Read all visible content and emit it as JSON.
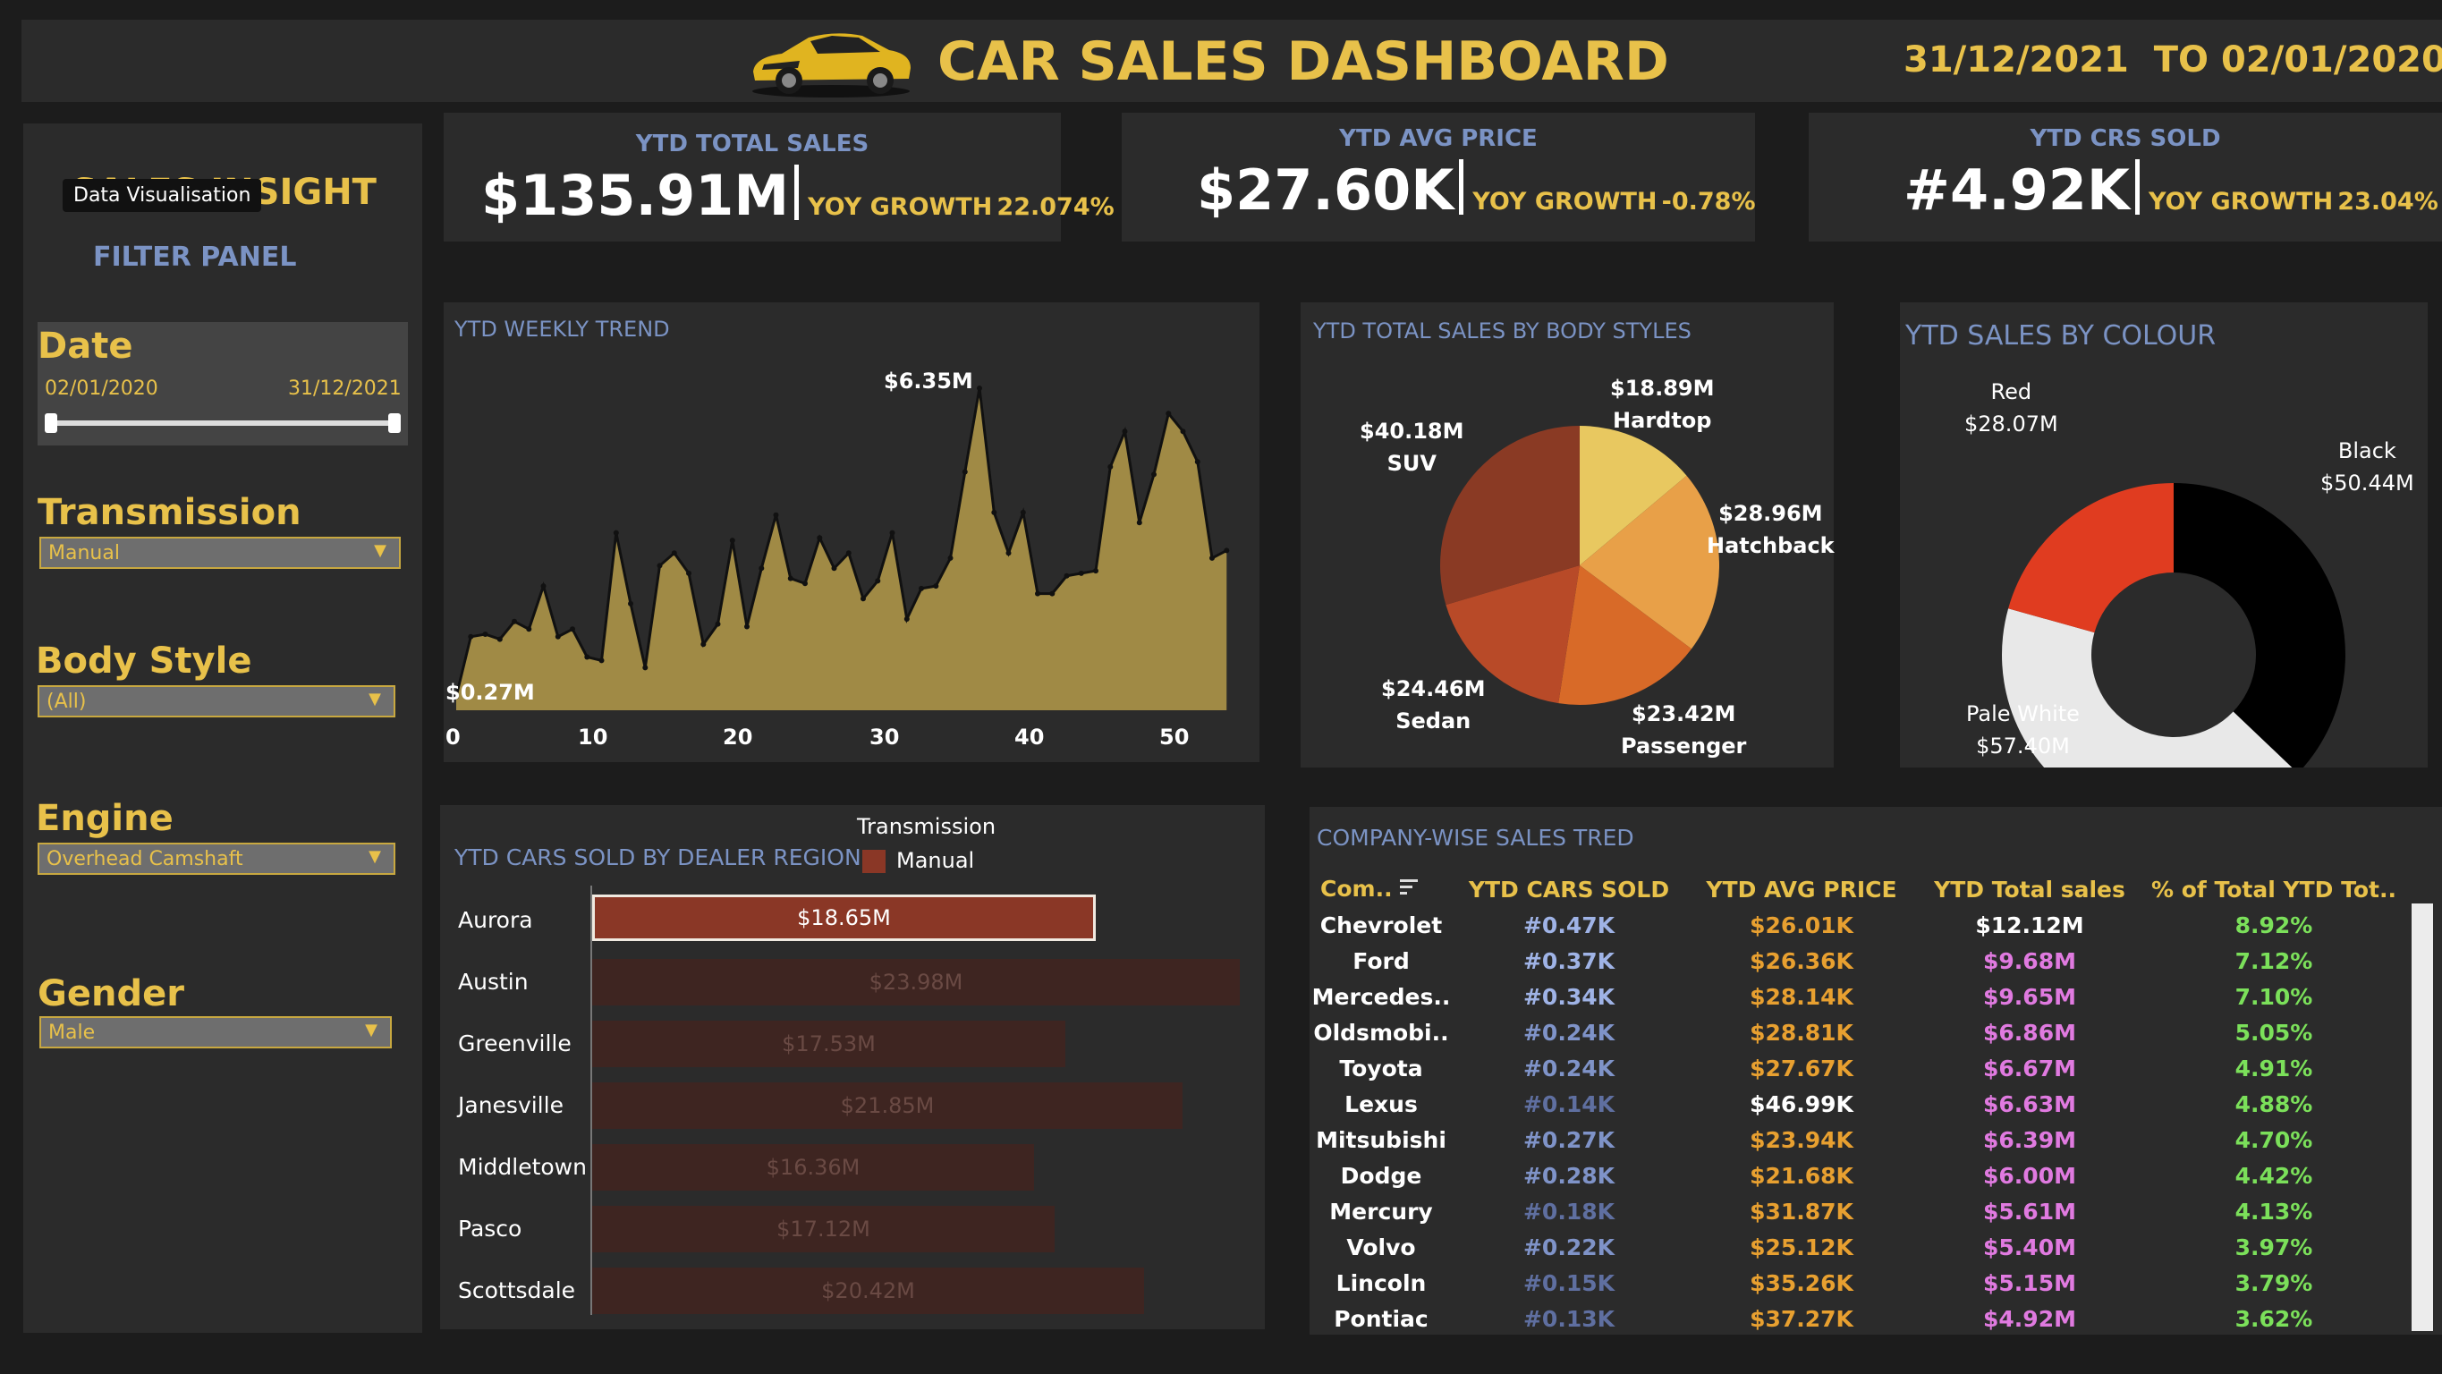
{
  "header": {
    "title": "CAR SALES DASHBOARD",
    "date_range": "31/12/2021  TO 02/01/2020"
  },
  "sidebar": {
    "heading": "SALES INSIGHT",
    "tooltip": "Data Visualisation",
    "filter_panel": "FILTER PANEL",
    "date": {
      "label": "Date",
      "start": "02/01/2020",
      "end": "31/12/2021"
    },
    "transmission": {
      "label": "Transmission",
      "value": "Manual"
    },
    "body_style": {
      "label": "Body Style",
      "value": "(All)"
    },
    "engine": {
      "label": "Engine",
      "value": "Overhead Camshaft"
    },
    "gender": {
      "label": "Gender",
      "value": "Male"
    }
  },
  "kpis": {
    "sales": {
      "title": "YTD TOTAL SALES",
      "value": "$135.91M",
      "yoy_label": "YOY GROWTH",
      "yoy": "22.074%"
    },
    "price": {
      "title": "YTD AVG PRICE",
      "value": "$27.60K",
      "yoy_label": "YOY GROWTH",
      "yoy": "-0.78%"
    },
    "sold": {
      "title": "YTD CRS SOLD",
      "value": "#4.92K",
      "yoy_label": "YOY GROWTH",
      "yoy": "23.04%"
    }
  },
  "weekly_trend": {
    "title": "YTD WEEKLY TREND",
    "max_label": "$6.35M",
    "min_label": "$0.27M",
    "x_ticks": [
      "0",
      "10",
      "20",
      "30",
      "40",
      "50"
    ]
  },
  "body_styles": {
    "title": "YTD TOTAL SALES BY BODY STYLES",
    "slices": [
      {
        "name": "Hardtop",
        "value": "$18.89M"
      },
      {
        "name": "Hatchback",
        "value": "$28.96M"
      },
      {
        "name": "Passenger",
        "value": "$23.42M"
      },
      {
        "name": "Sedan",
        "value": "$24.46M"
      },
      {
        "name": "SUV",
        "value": "$40.18M"
      }
    ]
  },
  "colour": {
    "title": "YTD SALES BY COLOUR",
    "slices": [
      {
        "name": "Black",
        "value": "$50.44M"
      },
      {
        "name": "Pale White",
        "value": "$57.40M"
      },
      {
        "name": "Red",
        "value": "$28.07M"
      }
    ]
  },
  "dealer_region": {
    "title": "YTD CARS SOLD BY DEALER REGION",
    "legend_title": "Transmission",
    "legend_item": "Manual",
    "regions": [
      {
        "name": "Aurora",
        "value": "$18.65M"
      },
      {
        "name": "Austin",
        "value": "$23.98M"
      },
      {
        "name": "Greenville",
        "value": "$17.53M"
      },
      {
        "name": "Janesville",
        "value": "$21.85M"
      },
      {
        "name": "Middletown",
        "value": "$16.36M"
      },
      {
        "name": "Pasco",
        "value": "$17.12M"
      },
      {
        "name": "Scottsdale",
        "value": "$20.42M"
      }
    ]
  },
  "company_table": {
    "title": "COMPANY-WISE SALES TRED",
    "headers": [
      "Com..",
      "YTD CARS SOLD",
      "YTD AVG PRICE",
      "YTD Total sales",
      "% of Total YTD Tot.."
    ],
    "rows": [
      [
        "Chevrolet",
        "#0.47K",
        "$26.01K",
        "$12.12M",
        "8.92%"
      ],
      [
        "Ford",
        "#0.37K",
        "$26.36K",
        "$9.68M",
        "7.12%"
      ],
      [
        "Mercedes..",
        "#0.34K",
        "$28.14K",
        "$9.65M",
        "7.10%"
      ],
      [
        "Oldsmobi..",
        "#0.24K",
        "$28.81K",
        "$6.86M",
        "5.05%"
      ],
      [
        "Toyota",
        "#0.24K",
        "$27.67K",
        "$6.67M",
        "4.91%"
      ],
      [
        "Lexus",
        "#0.14K",
        "$46.99K",
        "$6.63M",
        "4.88%"
      ],
      [
        "Mitsubishi",
        "#0.27K",
        "$23.94K",
        "$6.39M",
        "4.70%"
      ],
      [
        "Dodge",
        "#0.28K",
        "$21.68K",
        "$6.00M",
        "4.42%"
      ],
      [
        "Mercury",
        "#0.18K",
        "$31.87K",
        "$5.61M",
        "4.13%"
      ],
      [
        "Volvo",
        "#0.22K",
        "$25.12K",
        "$5.40M",
        "3.97%"
      ],
      [
        "Lincoln",
        "#0.15K",
        "$35.26K",
        "$5.15M",
        "3.79%"
      ],
      [
        "Pontiac",
        "#0.13K",
        "$37.27K",
        "$4.92M",
        "3.62%"
      ]
    ]
  },
  "chart_data": [
    {
      "type": "area",
      "title": "YTD WEEKLY TREND",
      "x": [
        0,
        1,
        2,
        3,
        4,
        5,
        6,
        7,
        8,
        9,
        10,
        11,
        12,
        13,
        14,
        15,
        16,
        17,
        18,
        19,
        20,
        21,
        22,
        23,
        24,
        25,
        26,
        27,
        28,
        29,
        30,
        31,
        32,
        33,
        34,
        35,
        36,
        37,
        38,
        39,
        40,
        41,
        42,
        43,
        44,
        45,
        46,
        47,
        48,
        49,
        50,
        51,
        52,
        53
      ],
      "values": [
        0.27,
        1.45,
        1.5,
        1.4,
        1.75,
        1.6,
        2.45,
        1.45,
        1.6,
        1.05,
        0.98,
        3.5,
        2.1,
        0.84,
        2.85,
        3.1,
        2.7,
        1.3,
        1.7,
        3.35,
        1.65,
        2.8,
        3.85,
        2.6,
        2.5,
        3.4,
        2.8,
        3.1,
        2.2,
        2.55,
        3.5,
        1.8,
        2.4,
        2.45,
        3.0,
        4.7,
        6.35,
        3.9,
        3.1,
        3.9,
        2.3,
        2.3,
        2.65,
        2.7,
        2.75,
        4.8,
        5.5,
        3.7,
        4.65,
        5.85,
        5.5,
        4.9,
        3.0,
        3.15
      ],
      "xlim": [
        0,
        53
      ],
      "ylim": [
        0,
        6.35
      ],
      "color": "#a08a45"
    },
    {
      "type": "pie",
      "title": "YTD TOTAL SALES BY BODY STYLES",
      "categories": [
        "Hardtop",
        "Hatchback",
        "Passenger",
        "Sedan",
        "SUV"
      ],
      "values": [
        18.89,
        28.96,
        23.42,
        24.46,
        40.18
      ],
      "colors": [
        "#e8c860",
        "#e8a048",
        "#d86a28",
        "#b84a28",
        "#8a3a24"
      ]
    },
    {
      "type": "pie",
      "title": "YTD SALES BY COLOUR",
      "categories": [
        "Black",
        "Pale White",
        "Red"
      ],
      "values": [
        50.44,
        57.4,
        28.07
      ],
      "colors": [
        "#000000",
        "#e8e8e8",
        "#e03c20"
      ]
    },
    {
      "type": "bar",
      "title": "YTD CARS SOLD BY DEALER REGION",
      "categories": [
        "Aurora",
        "Austin",
        "Greenville",
        "Janesville",
        "Middletown",
        "Pasco",
        "Scottsdale"
      ],
      "values": [
        18.65,
        23.98,
        17.53,
        21.85,
        16.36,
        17.12,
        20.42
      ],
      "xlim": [
        0,
        23.98
      ]
    }
  ]
}
